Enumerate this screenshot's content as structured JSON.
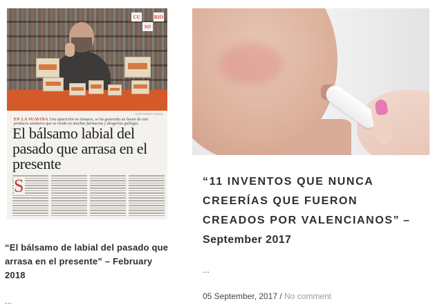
{
  "left_card": {
    "newspaper": {
      "crucio_letters": [
        "CU",
        "",
        "RIO",
        "",
        "SO",
        ""
      ],
      "kicker_label": "EN LA SUAVINA",
      "kicker_text": "Una aparición en Amazon, se ha generado un boom de este producto sanitario que se vende en muchas farmacias y drogerías gallegas",
      "headline": "El bálsamo labial del pasado que arrasa en el presente",
      "dropcap": "S",
      "photo_credit": "JOSÉ PARDO XUNGA"
    },
    "title": "“El bálsamo de labial del pasado que arrasa en el presente” – February 2018",
    "excerpt": "..."
  },
  "right_card": {
    "image_alt": "Mujer aplicándose bálsamo labial",
    "title_main": "“11 INVENTOS QUE NUNCA CREERÍAS QUE FUERON CREADOS POR VALENCIANOS”",
    "title_tail": " – September 2017",
    "excerpt": "...",
    "date": "05 September, 2017",
    "separator": " / ",
    "comments_link": "No comment"
  },
  "colors": {
    "link_muted": "#9d9d9d",
    "text": "#2e2e2e",
    "newspaper_accent": "#c0392b",
    "nail_pink": "#e57bb2"
  }
}
